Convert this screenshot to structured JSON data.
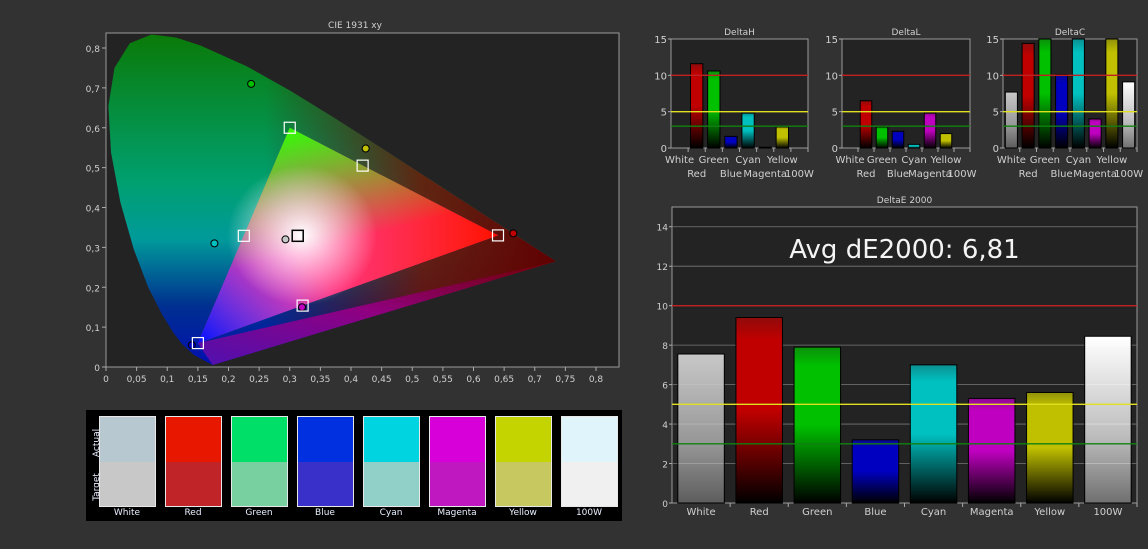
{
  "categories": [
    "White",
    "Red",
    "Green",
    "Blue",
    "Cyan",
    "Magenta",
    "Yellow",
    "100W"
  ],
  "colors": {
    "White": "#c8c8c8",
    "Red": "#c00000",
    "Green": "#00c000",
    "Blue": "#0000c0",
    "Cyan": "#00c0c0",
    "Magenta": "#c000c0",
    "Yellow": "#c0c000",
    "100W": "#ffffff",
    "threshold_red": "#c02020",
    "threshold_yellow": "#e0e020",
    "threshold_green": "#108010"
  },
  "chart_data": [
    {
      "type": "scatter",
      "title": "CIE 1931 xy",
      "xlabel": "",
      "ylabel": "",
      "xlim": [
        0,
        0.85
      ],
      "ylim": [
        0,
        0.84
      ],
      "x_ticks": [
        "0",
        "0,05",
        "0,1",
        "0,15",
        "0,2",
        "0,25",
        "0,3",
        "0,35",
        "0,4",
        "0,45",
        "0,5",
        "0,55",
        "0,6",
        "0,65",
        "0,7",
        "0,75",
        "0,8"
      ],
      "y_ticks": [
        "0",
        "0,1",
        "0,2",
        "0,3",
        "0,4",
        "0,5",
        "0,6",
        "0,7",
        "0,8"
      ],
      "series": [
        {
          "name": "Target",
          "marker": "square",
          "points": [
            {
              "label": "Red",
              "x": 0.64,
              "y": 0.33
            },
            {
              "label": "Green",
              "x": 0.3,
              "y": 0.6
            },
            {
              "label": "Blue",
              "x": 0.15,
              "y": 0.06
            },
            {
              "label": "Cyan",
              "x": 0.225,
              "y": 0.329
            },
            {
              "label": "Magenta",
              "x": 0.321,
              "y": 0.154
            },
            {
              "label": "Yellow",
              "x": 0.419,
              "y": 0.505
            },
            {
              "label": "White",
              "x": 0.313,
              "y": 0.329
            }
          ]
        },
        {
          "name": "Actual",
          "marker": "circle",
          "points": [
            {
              "label": "Red",
              "x": 0.665,
              "y": 0.335
            },
            {
              "label": "Green",
              "x": 0.237,
              "y": 0.71
            },
            {
              "label": "Blue",
              "x": 0.14,
              "y": 0.055
            },
            {
              "label": "Cyan",
              "x": 0.177,
              "y": 0.31
            },
            {
              "label": "Magenta",
              "x": 0.32,
              "y": 0.15
            },
            {
              "label": "Yellow",
              "x": 0.424,
              "y": 0.548
            },
            {
              "label": "White",
              "x": 0.293,
              "y": 0.32
            }
          ]
        }
      ]
    },
    {
      "type": "bar",
      "title": "DeltaH",
      "ylim": [
        0,
        15
      ],
      "y_ticks": [
        "0",
        "5",
        "10",
        "15"
      ],
      "thresholds": [
        10,
        5,
        3
      ],
      "values": [
        0,
        11.6,
        10.6,
        1.6,
        4.8,
        0.1,
        2.9,
        0
      ]
    },
    {
      "type": "bar",
      "title": "DeltaL",
      "ylim": [
        0,
        15
      ],
      "y_ticks": [
        "0",
        "5",
        "10",
        "15"
      ],
      "thresholds": [
        10,
        5,
        3
      ],
      "values": [
        0,
        6.5,
        2.9,
        2.3,
        0.5,
        4.8,
        2.0,
        0
      ]
    },
    {
      "type": "bar",
      "title": "DeltaC",
      "ylim": [
        0,
        15
      ],
      "y_ticks": [
        "0",
        "5",
        "10",
        "15"
      ],
      "thresholds": [
        10,
        5,
        3
      ],
      "values": [
        7.7,
        14.4,
        15,
        10.1,
        15,
        4.0,
        15,
        9.1
      ]
    },
    {
      "type": "bar",
      "title": "DeltaE 2000",
      "ylim": [
        0,
        15
      ],
      "y_ticks": [
        "0",
        "2",
        "4",
        "6",
        "8",
        "10",
        "12",
        "14"
      ],
      "thresholds": [
        10,
        5,
        3
      ],
      "annotation": "Avg dE2000: 6,81",
      "values": [
        7.55,
        9.4,
        7.9,
        3.2,
        7.0,
        5.3,
        5.6,
        8.45
      ]
    }
  ],
  "swatches": {
    "row_labels": {
      "actual": "Actual",
      "target": "Target"
    },
    "items": [
      {
        "label": "White",
        "actual": "#b8c8d0",
        "target": "#c8c8c8"
      },
      {
        "label": "Red",
        "actual": "#e81800",
        "target": "#c02428"
      },
      {
        "label": "Green",
        "actual": "#00e068",
        "target": "#78d0a0"
      },
      {
        "label": "Blue",
        "actual": "#0030e0",
        "target": "#3830c8"
      },
      {
        "label": "Cyan",
        "actual": "#00d4e0",
        "target": "#90d0c8"
      },
      {
        "label": "Magenta",
        "actual": "#d800d8",
        "target": "#c018c0"
      },
      {
        "label": "Yellow",
        "actual": "#c4d400",
        "target": "#c8c860"
      },
      {
        "label": "100W",
        "actual": "#e0f4fc",
        "target": "#f0f0f0"
      }
    ]
  }
}
